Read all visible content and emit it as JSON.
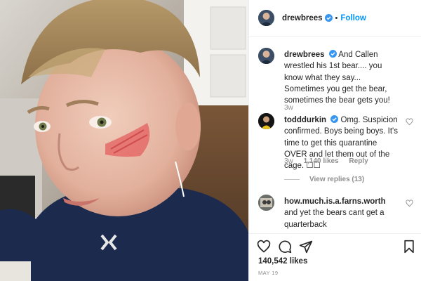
{
  "post": {
    "author": "drewbrees",
    "follow_label": "Follow",
    "separator": "•"
  },
  "caption": {
    "user": "drewbrees",
    "text": "And Callen wrestled his 1st bear.... you know what they say... Sometimes you get the bear, sometimes the bear gets you!",
    "age": "3w"
  },
  "comments": [
    {
      "user": "todddurkin",
      "text": "Omg. Suspicion confirmed. Boys being boys. It's time to get this quarantine OVER and let them out of the cage. ☐☐",
      "age": "3w",
      "likes": "1,140 likes",
      "reply_label": "Reply",
      "view_replies": "View replies (13)"
    },
    {
      "user": "how.much.is.a.farns.worth",
      "text": "and yet the bears cant get a quarterback"
    }
  ],
  "footer": {
    "likes": "140,542 likes",
    "date": "MAY 19"
  },
  "icons": {
    "verified": "verified-badge-icon",
    "heart": "heart-icon",
    "comment": "comment-icon",
    "share": "share-icon",
    "save": "bookmark-icon"
  },
  "colors": {
    "link_blue": "#0095f6",
    "verified_blue": "#3897f0",
    "muted": "#8e8e8e",
    "text": "#262626"
  }
}
